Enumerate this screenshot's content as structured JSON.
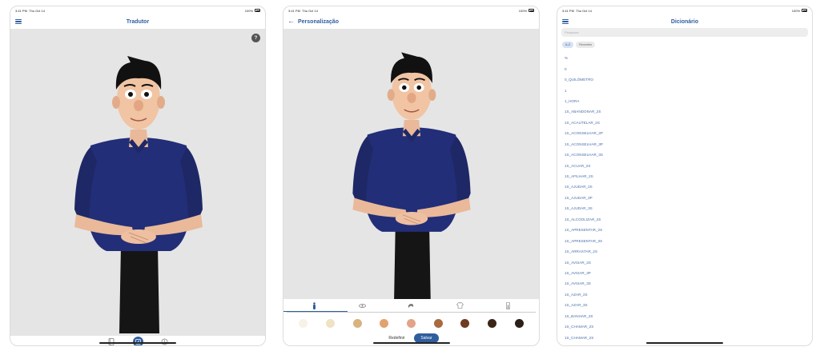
{
  "status": {
    "time": "3:41 PM",
    "date": "Thu Oct 14",
    "battery": "100%"
  },
  "translator": {
    "title": "Tradutor",
    "help_label": "?"
  },
  "customize": {
    "title": "Personalização",
    "tabs": [
      {
        "icon": "body-icon"
      },
      {
        "icon": "eye-icon"
      },
      {
        "icon": "hair-icon"
      },
      {
        "icon": "shirt-icon"
      },
      {
        "icon": "pants-icon"
      }
    ],
    "skin_tones": [
      "#f7f2e6",
      "#efe3c4",
      "#d9b27e",
      "#e0a36f",
      "#e2a488",
      "#a86a3e",
      "#6f3b22",
      "#3a2516",
      "#2b1f18"
    ],
    "reset_label": "Redefinir",
    "save_label": "Salvar"
  },
  "dictionary": {
    "title": "Dicionário",
    "search_placeholder": "Pesquisar",
    "chips": [
      {
        "label": "A-Z"
      },
      {
        "label": "Recentes"
      }
    ],
    "items": [
      "%",
      "0",
      "0_QUILÔMETRO",
      "1",
      "1_HORA",
      "1S_ABANDONAR_2S",
      "1S_ACAUTELAR_2S",
      "1S_ACONSELHAR_2P",
      "1S_ACONSELHAR_3P",
      "1S_ACONSELHAR_3S",
      "1S_ACUAR_2S",
      "1S_AFILHAR_2S",
      "1S_AJUDAR_2S",
      "1S_AJUDAR_3P",
      "1S_AJUDAR_3S",
      "1S_ALCOOLIZAR_2S",
      "1S_APRESENTAR_2S",
      "1S_APRESENTAR_3S",
      "1S_ARRASTAR_2S",
      "1S_AVISAR_2S",
      "1S_AVISAR_3P",
      "1S_AVISAR_3S",
      "1S_AZAR_2S",
      "1S_AZAR_3S",
      "1S_BANHAR_2S",
      "1S_CHAMAR_2S",
      "1S_CHAMAR_2S"
    ]
  }
}
